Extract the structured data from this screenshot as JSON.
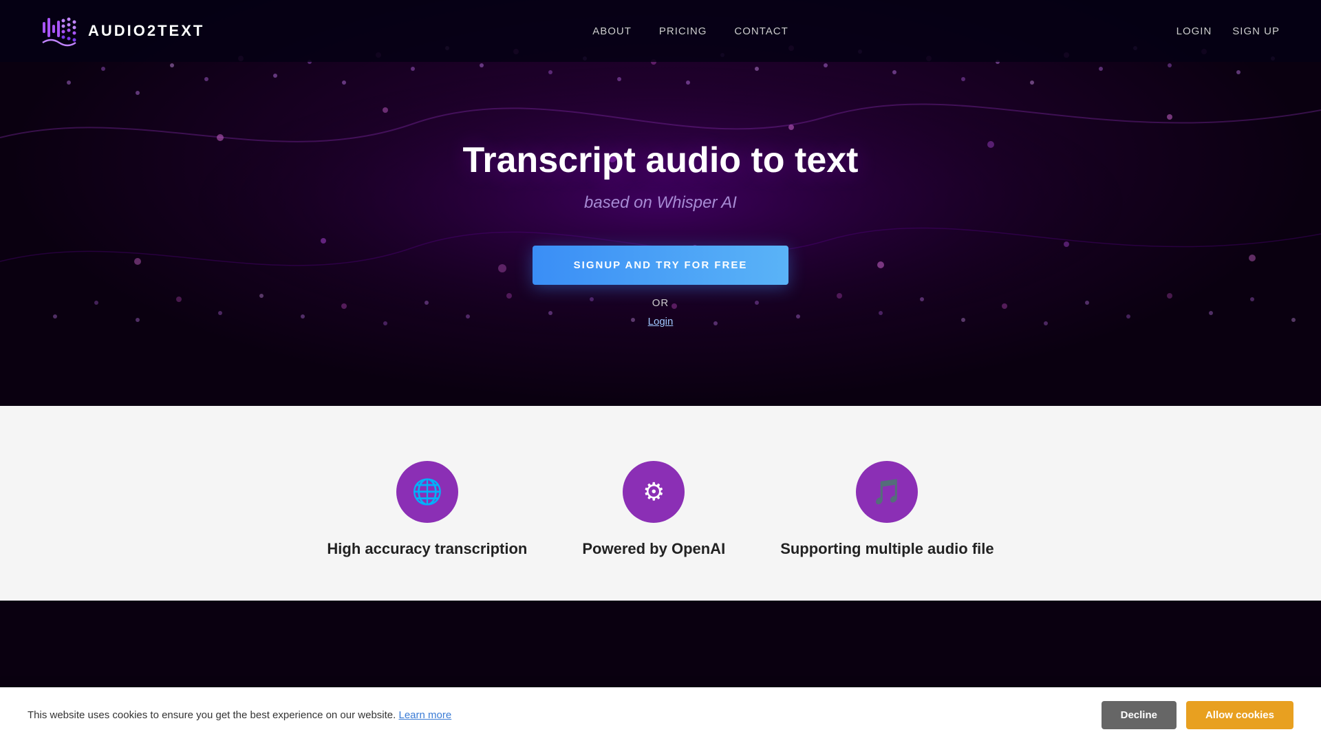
{
  "brand": {
    "name": "AUDIO2TEXT",
    "logo_alt": "Audio2Text Logo"
  },
  "nav": {
    "links": [
      {
        "label": "ABOUT",
        "href": "#about"
      },
      {
        "label": "PRICING",
        "href": "#pricing"
      },
      {
        "label": "CONTACT",
        "href": "#contact"
      }
    ],
    "auth": [
      {
        "label": "LOGIN",
        "href": "#login"
      },
      {
        "label": "SIGN UP",
        "href": "#signup"
      }
    ]
  },
  "hero": {
    "title": "Transcript audio to text",
    "subtitle": "based on Whisper AI",
    "cta_label": "SIGNUP AND TRY FOR FREE",
    "or_label": "OR",
    "login_label": "Login"
  },
  "features": [
    {
      "icon": "🌐",
      "title": "High accuracy transcription",
      "icon_name": "globe-icon"
    },
    {
      "icon": "⚙",
      "title": "Powered by OpenAI",
      "icon_name": "gears-icon"
    },
    {
      "icon": "🎵",
      "title": "Supporting multiple audio file",
      "icon_name": "music-icon"
    }
  ],
  "cookie": {
    "message": "This website uses cookies to ensure you get the best experience on our website.",
    "learn_more_label": "Learn more",
    "decline_label": "Decline",
    "allow_label": "Allow cookies"
  },
  "colors": {
    "accent_purple": "#8b2fb5",
    "accent_blue": "#3a8ef6",
    "accent_yellow": "#e8a020"
  }
}
